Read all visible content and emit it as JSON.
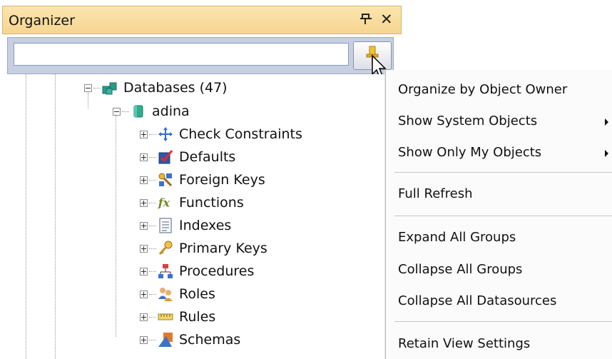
{
  "panel": {
    "title": "Organizer",
    "search": {
      "value": "",
      "placeholder": ""
    }
  },
  "tree": {
    "root": {
      "label": "Databases (47)",
      "icon": "databases-icon"
    },
    "database": {
      "label": "adina",
      "icon": "database-icon"
    },
    "items": [
      {
        "label": "Check Constraints",
        "icon": "check-constraints-icon"
      },
      {
        "label": "Defaults",
        "icon": "defaults-icon"
      },
      {
        "label": "Foreign Keys",
        "icon": "foreign-keys-icon"
      },
      {
        "label": "Functions",
        "icon": "functions-icon"
      },
      {
        "label": "Indexes",
        "icon": "indexes-icon"
      },
      {
        "label": "Primary Keys",
        "icon": "primary-keys-icon"
      },
      {
        "label": "Procedures",
        "icon": "procedures-icon"
      },
      {
        "label": "Roles",
        "icon": "roles-icon"
      },
      {
        "label": "Rules",
        "icon": "rules-icon"
      },
      {
        "label": "Schemas",
        "icon": "schemas-icon"
      }
    ]
  },
  "menu": {
    "items": [
      {
        "label": "Organize by Object Owner",
        "submenu": false
      },
      {
        "label": "Show System Objects",
        "submenu": true
      },
      {
        "label": "Show Only My Objects",
        "submenu": true
      },
      {
        "label": "Full Refresh",
        "submenu": false
      },
      {
        "label": "Expand All Groups",
        "submenu": false
      },
      {
        "label": "Collapse All Groups",
        "submenu": false
      },
      {
        "label": "Collapse All Datasources",
        "submenu": false
      },
      {
        "label": "Retain View Settings",
        "submenu": false
      }
    ]
  },
  "colors": {
    "titlebar": "#f6d591",
    "search_area": "#c8cfe0",
    "menu_background": "#fbfbfb"
  }
}
